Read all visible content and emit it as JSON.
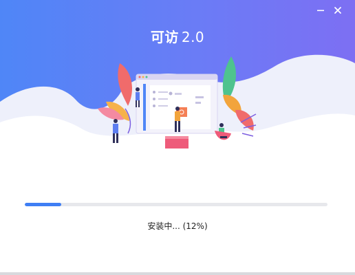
{
  "window": {
    "title_mark": "可访",
    "title_version": "2.0",
    "minimize_icon": "minimize-icon",
    "close_icon": "close-icon"
  },
  "install": {
    "status_text": "安装中... (12%)",
    "progress": 0.12
  },
  "colors": {
    "accent": "#3f7ef4",
    "hero_start": "#4f86f7",
    "hero_end": "#7d6ff3",
    "track": "#e7e8ec"
  }
}
